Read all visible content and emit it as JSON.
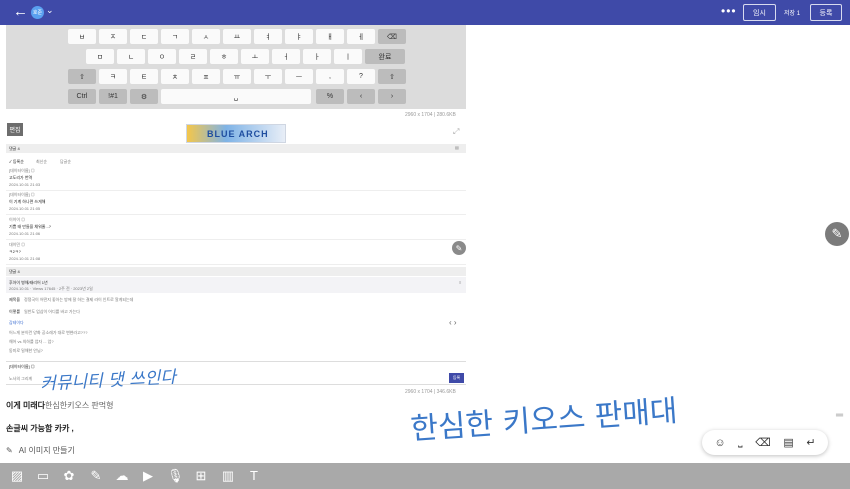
{
  "header": {
    "back_icon": "arrow-left-icon",
    "avatar_label": "호준",
    "more_icon": "more-dots-icon",
    "temp_label": "임시",
    "temp_count": "저장 1",
    "post_label": "등록"
  },
  "keyboard": {
    "row1": [
      "ㅂ",
      "ㅈ",
      "ㄷ",
      "ㄱ",
      "ㅅ",
      "ㅛ",
      "ㅕ",
      "ㅑ",
      "ㅐ",
      "ㅔ",
      "⌫"
    ],
    "row2": [
      "ㅁ",
      "ㄴ",
      "ㅇ",
      "ㄹ",
      "ㅎ",
      "ㅗ",
      "ㅓ",
      "ㅏ",
      "ㅣ",
      "완료"
    ],
    "row3": [
      "⇧",
      "ㅋ",
      "ㅌ",
      "ㅊ",
      "ㅍ",
      "ㅠ",
      "ㅜ",
      "ㅡ",
      ",",
      "?",
      "⇧"
    ],
    "row4": [
      "Ctrl",
      "!#1",
      "⚙",
      "␣",
      "%",
      "‹",
      "›"
    ]
  },
  "image1_dimensions": "2960 x 1704 | 280.6KB",
  "post": {
    "edit_label": "편집",
    "banner_text": "BLUE ARCH",
    "comments_header": "댓글 4",
    "sort_options": [
      "✓ 등록순",
      "최신순",
      "답글순"
    ],
    "comments": [
      {
        "author": "[데이터이름] ◎",
        "text": "고도리가 번역",
        "date": "2024.10.01 21:03"
      },
      {
        "author": "[데이터이름] ◎",
        "text": "이 기계 하나면 쓰게해",
        "date": "2024.10.01 21:05"
      },
      {
        "author": "이이이 ◎",
        "text": "기쁨 태 만들을 채워줄...?",
        "date": "2024.10.01 21:06"
      },
      {
        "author": "대이민 ◎",
        "text": "ㅋ2ㅋ?",
        "date": "2024.10.01 21:08"
      }
    ],
    "comments2_header": "댓글 4",
    "highlight_title": "후아이 병해/태리어 1년",
    "highlight_sub": "2024.10.01 · Views 17645 · 2주 전 · 2023년 2일",
    "detail_rows": [
      {
        "label": "제목을",
        "text": "정쟁국이 어떤지 좋아는 방에 잘 하는 결제 라이 인트로 알게되는데"
      },
      {
        "label": "이렇를",
        "text": "일반도 엄삼이 어디를 바고 가는다"
      }
    ],
    "thread_title": "감테이다",
    "thread_lines": [
      "어느게 분이런 양화 공소래가 대로 변현라고???",
      "해어 vs 의하를 업자 ... 엄?",
      "동미로 밀해한 안님?"
    ],
    "reply_author": "[데이터이름] ◎",
    "reply_placeholder": "노사의 그리게",
    "reply_button": "등록",
    "handwriting_small": "커뮤니티 댓 쓰인다"
  },
  "image2_dimensions": "2960 x 1704 | 346.6KB",
  "body": {
    "line1_bold": "이게 미래다",
    "line1_light": "한심한키오스 판먹형",
    "line2": "손글씨 가능함 카카 ,",
    "ai_label": "AI 이미지 만들기",
    "handwriting_large": "한심한 키오스 판매대"
  },
  "kb_tools": [
    "emoji-icon",
    "space-icon",
    "backspace-icon",
    "keyboard-icon",
    "enter-icon"
  ],
  "bottom_icons": [
    "image-icon",
    "video-icon",
    "sticker-icon",
    "edit-icon",
    "cloud-icon",
    "youtube-icon",
    "mic-icon",
    "grid-icon",
    "chart-icon",
    "text-icon"
  ],
  "colors": {
    "topbar": "#3f4aa8",
    "bottombar": "#a9a9a9",
    "ink": "#3b78c8"
  }
}
